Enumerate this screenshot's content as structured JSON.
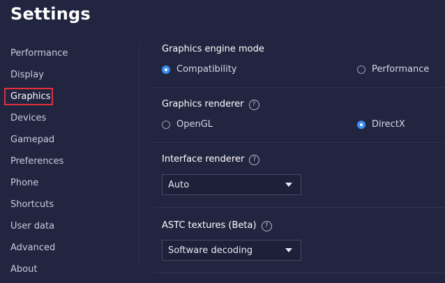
{
  "page": {
    "title": "Settings"
  },
  "sidebar": {
    "items": [
      {
        "label": "Performance"
      },
      {
        "label": "Display"
      },
      {
        "label": "Graphics"
      },
      {
        "label": "Devices"
      },
      {
        "label": "Gamepad"
      },
      {
        "label": "Preferences"
      },
      {
        "label": "Phone"
      },
      {
        "label": "Shortcuts"
      },
      {
        "label": "User data"
      },
      {
        "label": "Advanced"
      },
      {
        "label": "About"
      }
    ],
    "active_item": "Graphics"
  },
  "graphics_engine_mode": {
    "title": "Graphics engine mode",
    "options": [
      {
        "label": "Compatibility",
        "selected": true
      },
      {
        "label": "Performance",
        "selected": false
      }
    ]
  },
  "graphics_renderer": {
    "title": "Graphics renderer",
    "help_icon": "?",
    "options": [
      {
        "label": "OpenGL",
        "selected": false
      },
      {
        "label": "DirectX",
        "selected": true
      }
    ]
  },
  "interface_renderer": {
    "title": "Interface renderer",
    "help_icon": "?",
    "selected_value": "Auto"
  },
  "astc_textures": {
    "title": "ASTC textures (Beta)",
    "help_icon": "?",
    "selected_value": "Software decoding"
  },
  "colors": {
    "background": "#222540",
    "accent": "#3a8ef0",
    "highlight_box": "#e0303a"
  }
}
